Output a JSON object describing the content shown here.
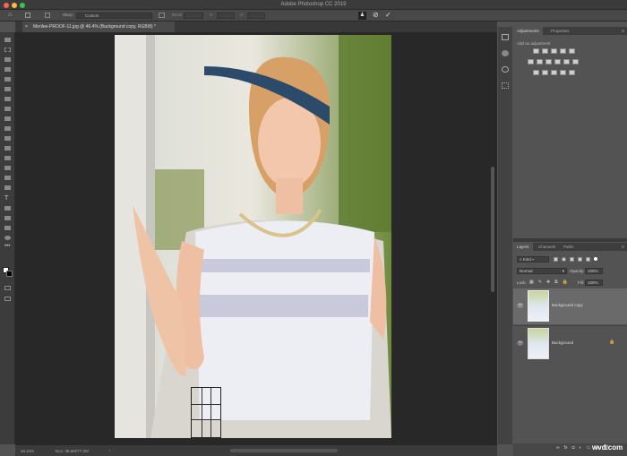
{
  "window": {
    "title": "Adobe Photoshop CC 2019"
  },
  "options_bar": {
    "warp_label": "Warp:",
    "warp_value": "Custom",
    "bend_label": "Bend:",
    "h_label": "H:",
    "v_label": "V:",
    "cancel_icon": "cancel-icon",
    "commit_icon": "check-icon"
  },
  "document_tab": {
    "title": "Merilee-PROOF-11.jpg @ 46.4% (Background copy, RGB/8) *",
    "close": "×"
  },
  "status_bar": {
    "zoom": "46.44%",
    "doc": "Doc: 38.6M/77.2M",
    "arrow": "›"
  },
  "adjustments": {
    "tabs": [
      "Adjustments",
      "Properties"
    ],
    "hint": "Add an adjustment"
  },
  "layers": {
    "tabs": [
      "Layers",
      "Channels",
      "Paths"
    ],
    "filter": "Kind",
    "blend_mode": "Normal",
    "opacity_label": "Opacity:",
    "opacity": "100%",
    "lock_label": "Lock:",
    "fill_label": "Fill:",
    "fill": "100%",
    "items": [
      {
        "name": "Background copy",
        "selected": true
      },
      {
        "name": "Background",
        "locked": true
      }
    ]
  },
  "watermark": "wvd.com"
}
